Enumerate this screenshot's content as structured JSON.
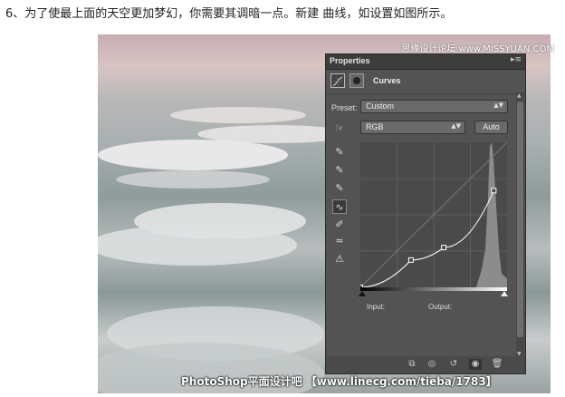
{
  "instruction": "6、为了使最上面的天空更加梦幻，你需要其调暗一点。新建 曲线，如设置如图所示。",
  "watermark_top": "思缘设计论坛 www.MISSYUAN.COM",
  "watermark_bottom": "PhotoShop平面设计吧 【www.linecg.com/tieba/1783】",
  "panel": {
    "title": "Properties",
    "header_label": "Curves",
    "preset_label": "Preset:",
    "preset_value": "Custom",
    "channel_value": "RGB",
    "auto_label": "Auto",
    "input_label": "Input:",
    "output_label": "Output:"
  },
  "icons": {
    "panel_menu": "panel-menu-icon",
    "curves": "curves-adjustment-icon",
    "mask": "layer-mask-icon",
    "on_image": "on-image-adjust-icon",
    "eyedropper_black": "eyedropper-black-icon",
    "eyedropper_gray": "eyedropper-gray-icon",
    "eyedropper_white": "eyedropper-white-icon",
    "point_edit": "curve-point-icon",
    "pencil": "pencil-icon",
    "smooth": "smooth-curve-icon",
    "clip_warning": "clipping-warning-icon",
    "clip_layer": "clip-to-layer-icon",
    "view_previous": "view-previous-icon",
    "reset": "reset-icon",
    "visibility": "visibility-eye-icon",
    "delete": "trash-icon"
  },
  "curve_points": [
    [
      0,
      0
    ],
    [
      88,
      48
    ],
    [
      145,
      70
    ],
    [
      232,
      170
    ]
  ],
  "colors": {
    "panel_bg": "#535353",
    "graph_bg": "#4a4a4a",
    "curve": "#ffffff",
    "histogram": "#8c8c8c"
  }
}
